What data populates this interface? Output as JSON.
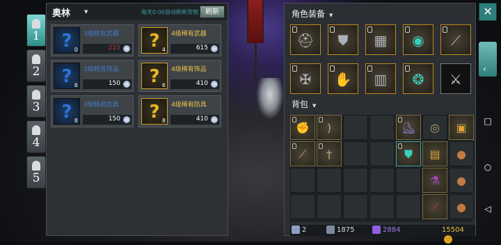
{
  "tabs": [
    "1",
    "2",
    "3",
    "4",
    "5"
  ],
  "shop": {
    "title": "奥林",
    "refresh_note": "每天0:00自动刷新货物",
    "refresh_label": "刷新",
    "items": [
      {
        "name": "3级精良武器",
        "price": "225",
        "count": "0",
        "rarity": "blue",
        "price_insufficient": true
      },
      {
        "name": "4级稀有武器",
        "price": "615",
        "count": "4",
        "rarity": "gold",
        "price_insufficient": false
      },
      {
        "name": "3级精良饰品",
        "price": "150",
        "count": "6",
        "rarity": "blue",
        "price_insufficient": false
      },
      {
        "name": "4级稀有饰品",
        "price": "410",
        "count": "6",
        "rarity": "gold",
        "price_insufficient": false
      },
      {
        "name": "3级精良防具",
        "price": "150",
        "count": "8",
        "rarity": "blue",
        "price_insufficient": false
      },
      {
        "name": "4级稀有防具",
        "price": "410",
        "count": "8",
        "rarity": "gold",
        "price_insufficient": false
      }
    ]
  },
  "equipment": {
    "title": "角色装备",
    "slots": [
      "helmet-icon",
      "armor-icon",
      "chest-icon",
      "ring-icon",
      "staff-icon",
      "boots-icon",
      "gauntlet-icon",
      "legs-icon",
      "amulet-icon",
      "sword-icon"
    ]
  },
  "bag": {
    "title": "背包",
    "status": {
      "arrows": "2",
      "shield": "1875",
      "crystals": "2884",
      "gold": "15504"
    }
  },
  "colors": {
    "accent": "#2e7f7b",
    "rare_gold": "#ecc24a",
    "fine_blue": "#4a78c8",
    "price_red": "#c0392b"
  },
  "system": {
    "close": "✕",
    "nav_recent": "□",
    "nav_home": "○",
    "nav_back": "◁",
    "side_arrow": "‹"
  }
}
